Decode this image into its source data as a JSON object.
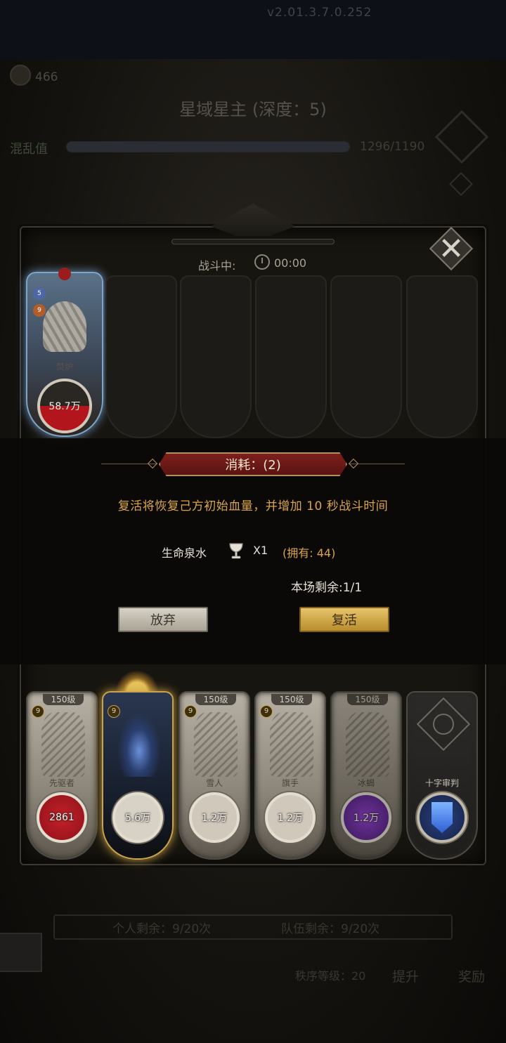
{
  "top": {
    "version": "v2.01.3.7.0.252",
    "currency": "466",
    "stage_title": "星域星主 (深度：5)",
    "chaos_label": "混乱值",
    "chaos_value": "1296/1190",
    "chaos_fraction": 1.0
  },
  "battle": {
    "status_label": "战斗中:",
    "timer": "00:00",
    "ally": {
      "name": "焚炉",
      "hp": "58.7万",
      "hp_fraction": 0.5,
      "badge_a": "5",
      "badge_b": "9"
    }
  },
  "dialog": {
    "cost_title": "消耗：(2)",
    "description": "复活将恢复己方初始血量，并增加 10 秒战斗时间",
    "item_name": "生命泉水",
    "item_icon": "chalice-icon",
    "item_qty": "X1",
    "item_owned": "(拥有: 44)",
    "remaining": "本场剩余:1/1",
    "giveup_label": "放弃",
    "revive_label": "复活"
  },
  "heroes": [
    {
      "level": "150级",
      "star": "9",
      "name": "先驱者",
      "hp": "2861"
    },
    {
      "level": "",
      "star": "9",
      "name": "",
      "hp": "5.6万"
    },
    {
      "level": "150级",
      "star": "9",
      "name": "雪人",
      "hp": "1.2万"
    },
    {
      "level": "150级",
      "star": "9",
      "name": "旗手",
      "hp": "1.2万"
    },
    {
      "level": "150级",
      "star": "",
      "name": "冰蝎",
      "hp": "1.2万"
    },
    {
      "name": "十字审判",
      "icon": "cross-banner-icon"
    }
  ],
  "bottom": {
    "personal_left": "个人剩余：9/20次",
    "team_left": "队伍剩余：9/20次",
    "order_level": "秩序等级：20",
    "upgrade_label": "提升",
    "reward_label": "奖励"
  },
  "colors": {
    "accent_gold": "#d9a548",
    "banner_red": "#7d1f1c",
    "hp_red": "#b3151c"
  }
}
